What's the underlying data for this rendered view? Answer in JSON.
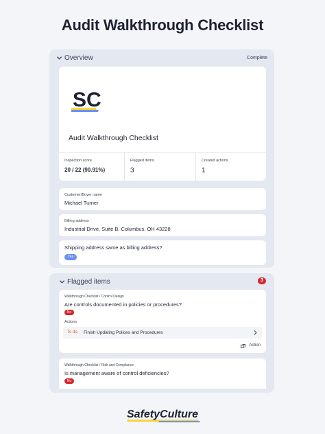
{
  "page": {
    "title": "Audit Walkthrough Checklist"
  },
  "overview": {
    "section_title": "Overview",
    "status": "Complete",
    "report_title": "Audit Walkthrough Checklist",
    "logo_text": "SC",
    "stats": [
      {
        "label": "Inspection score",
        "value": "20 / 22 (90.91%)"
      },
      {
        "label": "Flagged items",
        "value": "3"
      },
      {
        "label": "Created actions",
        "value": "1"
      }
    ],
    "fields": [
      {
        "label": "Customer/Buyer name",
        "value": "Michael Turner"
      },
      {
        "label": "Billing address",
        "value": "Industrial Drive, Suite B, Columbus, OH 43228"
      }
    ],
    "shipping": {
      "question": "Shipping address same as billing address?",
      "answer": "Yes"
    }
  },
  "flagged": {
    "section_title": "Flagged items",
    "count": "3",
    "items": [
      {
        "breadcrumb": "Walkthrough Checklist / Control Design",
        "question": "Are controls documented in policies or procedures?",
        "answer": "No",
        "actions_label": "Actions",
        "action_status": "To do",
        "action_text": "Finish Updating Polices and Procedures",
        "action_button": "Action"
      },
      {
        "breadcrumb": "Walkthrough Checklist / Risk and Compliance",
        "question": "Is management aware of control deficiencies?",
        "answer": "No"
      }
    ]
  },
  "brand": {
    "name": "SafetyCulture"
  },
  "colors": {
    "accent": "#6c8ff3",
    "danger": "#d6262d",
    "todo": "#e0621a",
    "panel": "#e4e8f1"
  },
  "icons": [
    "chevron-down-icon",
    "chevron-right-icon",
    "action-icon"
  ]
}
